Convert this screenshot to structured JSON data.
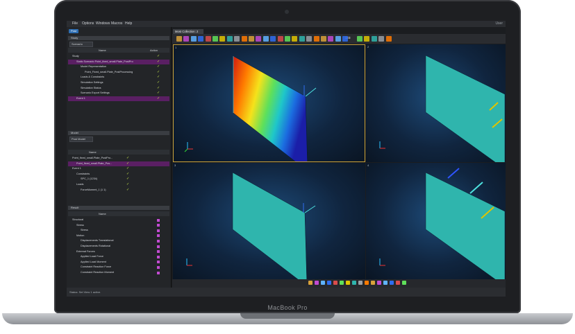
{
  "device": {
    "label": "MacBook Pro"
  },
  "menu": {
    "items": [
      "File",
      "Options",
      "Windows",
      "Macros",
      "Help"
    ],
    "right": "User"
  },
  "left_panel": {
    "tab": "Post",
    "study": {
      "header": "Study",
      "dropdown": "Scenario",
      "col_name": "Name",
      "col_action": "Action",
      "rows": [
        {
          "label": "Study",
          "indent": 0,
          "selected": false
        },
        {
          "label": "Static Scenario Point_fixed_small.Plate_PostPro",
          "indent": 1,
          "selected": true
        },
        {
          "label": "Model Representation",
          "indent": 2,
          "selected": false
        },
        {
          "label": "Point_Fixed_small.Plate_PostProcessing",
          "indent": 3,
          "selected": false
        },
        {
          "label": "Loads & Constraints",
          "indent": 2,
          "selected": false
        },
        {
          "label": "Simulation Settings",
          "indent": 2,
          "selected": false
        },
        {
          "label": "Simulation Status",
          "indent": 2,
          "selected": false
        },
        {
          "label": "Scenario Export Settings",
          "indent": 2,
          "selected": false
        },
        {
          "label": "Event 1",
          "indent": 1,
          "selected": true
        }
      ]
    },
    "model": {
      "header": "Model",
      "dropdown": "Post Model",
      "col_name": "Name",
      "rows": [
        {
          "label": "Point_fixed_small.Plate_PostPro...",
          "indent": 0,
          "selected": false
        },
        {
          "label": "Point_fixed_small.Plate_Pos...",
          "indent": 1,
          "selected": true
        },
        {
          "label": "Event 1",
          "indent": 0,
          "selected": false
        },
        {
          "label": "Constraints",
          "indent": 1,
          "selected": false
        },
        {
          "label": "SPC_1 (1234)",
          "indent": 2,
          "selected": false
        },
        {
          "label": "Loads",
          "indent": 1,
          "selected": false
        },
        {
          "label": "ForceMoment_1 (1 1)",
          "indent": 2,
          "selected": false
        }
      ]
    },
    "result": {
      "header": "Result",
      "col_name": "Name",
      "rows": [
        {
          "label": "Structural",
          "indent": 0
        },
        {
          "label": "Stress",
          "indent": 1
        },
        {
          "label": "Stress",
          "indent": 2
        },
        {
          "label": "Motion",
          "indent": 1
        },
        {
          "label": "Displacements Translational",
          "indent": 2
        },
        {
          "label": "Displacements Rotational",
          "indent": 2
        },
        {
          "label": "External Forces",
          "indent": 1
        },
        {
          "label": "Applied Load Force",
          "indent": 2
        },
        {
          "label": "Applied Load Moment",
          "indent": 2
        },
        {
          "label": "Constraint Reaction Force",
          "indent": 2
        },
        {
          "label": "Constraint Reaction Moment",
          "indent": 2
        }
      ]
    }
  },
  "workspace": {
    "collection_tab": "Most Collection: 2",
    "toolbar_number": "123",
    "viewports": [
      "1",
      "2",
      "3",
      "4"
    ]
  },
  "status": "Status: Set View 1 active.",
  "colors": {
    "accent": "#2f6fb3",
    "selection": "#5a1f63",
    "plate": "#2fb5ad",
    "check": "#c7e84a"
  }
}
